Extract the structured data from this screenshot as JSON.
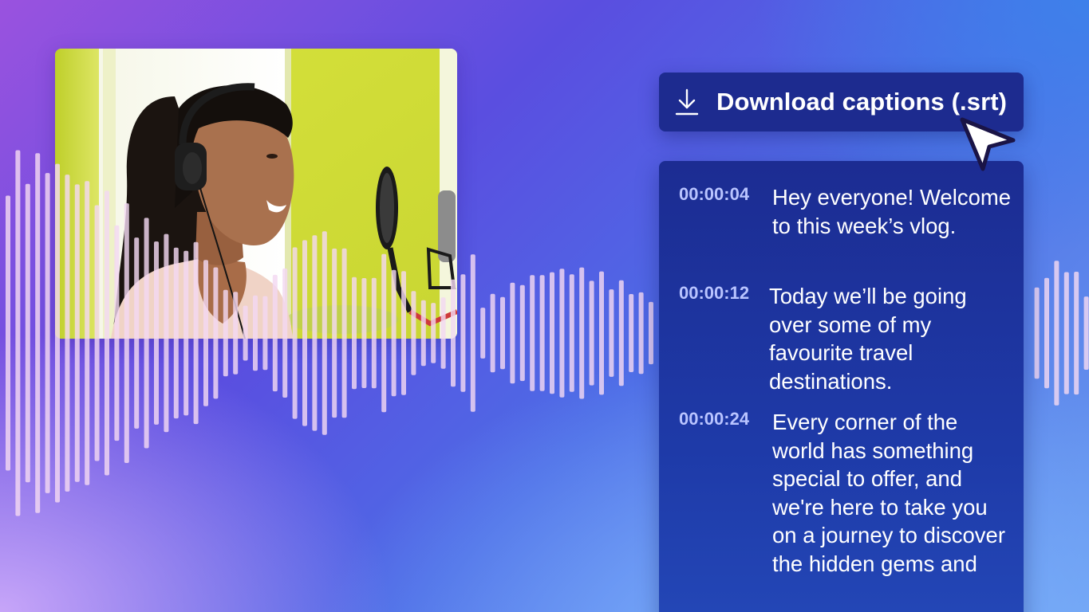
{
  "download_button": {
    "label": "Download captions (.srt)",
    "icon": "download-icon"
  },
  "captions": [
    {
      "time": "00:00:04",
      "text": "Hey everyone! Welcome to this week’s vlog."
    },
    {
      "time": "00:00:12",
      "text": "Today we’ll be going over some of my favourite travel destinations."
    },
    {
      "time": "00:00:24",
      "text": "Every corner of the world has something special to offer, and we're here to take you on a journey to discover the hidden gems and"
    }
  ],
  "colors": {
    "panel_bg": "#1d2b8f",
    "timestamp": "#b9c4ff",
    "caption_text": "#ffffff",
    "waveform": "#f3d8f2",
    "photo_wall": "#d6e23a"
  },
  "icons": [
    "download-icon",
    "pointer-cursor-icon"
  ]
}
